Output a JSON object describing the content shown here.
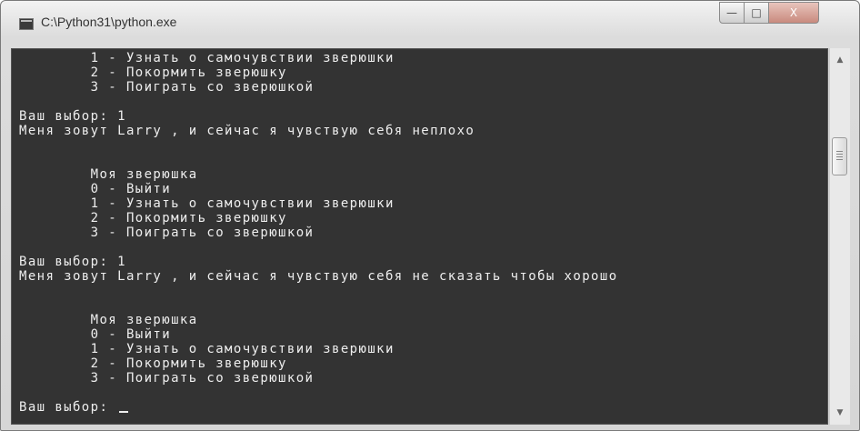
{
  "window": {
    "title": "C:\\Python31\\python.exe"
  },
  "controls": {
    "minimize_glyph": "—",
    "maximize_glyph": "□",
    "close_glyph": "X"
  },
  "console": {
    "lines": [
      "        1 - Узнать о самочувствии зверюшки",
      "        2 - Покормить зверюшку",
      "        3 - Поиграть со зверюшкой",
      "",
      "Ваш выбор: 1",
      "Меня зовут Larry , и сейчас я чувствую себя неплохо",
      "",
      "",
      "        Моя зверюшка",
      "        0 - Выйти",
      "        1 - Узнать о самочувствии зверюшки",
      "        2 - Покормить зверюшку",
      "        3 - Поиграть со зверюшкой",
      "",
      "Ваш выбор: 1",
      "Меня зовут Larry , и сейчас я чувствую себя не сказать чтобы хорошо",
      "",
      "",
      "        Моя зверюшка",
      "        0 - Выйти",
      "        1 - Узнать о самочувствии зверюшки",
      "        2 - Покормить зверюшку",
      "        3 - Поиграть со зверюшкой",
      "",
      "Ваш выбор: "
    ]
  },
  "scrollbar": {
    "up_glyph": "▲",
    "down_glyph": "▼"
  }
}
